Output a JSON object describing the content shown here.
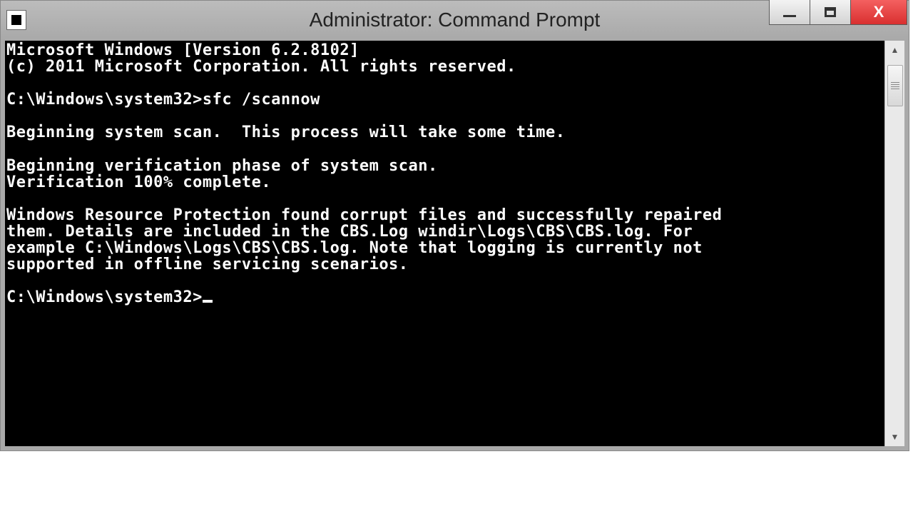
{
  "window": {
    "title": "Administrator: Command Prompt"
  },
  "console": {
    "lines": [
      "Microsoft Windows [Version 6.2.8102]",
      "(c) 2011 Microsoft Corporation. All rights reserved.",
      "",
      "C:\\Windows\\system32>sfc /scannow",
      "",
      "Beginning system scan.  This process will take some time.",
      "",
      "Beginning verification phase of system scan.",
      "Verification 100% complete.",
      "",
      "Windows Resource Protection found corrupt files and successfully repaired",
      "them. Details are included in the CBS.Log windir\\Logs\\CBS\\CBS.log. For",
      "example C:\\Windows\\Logs\\CBS\\CBS.log. Note that logging is currently not",
      "supported in offline servicing scenarios.",
      "",
      "C:\\Windows\\system32>"
    ]
  }
}
